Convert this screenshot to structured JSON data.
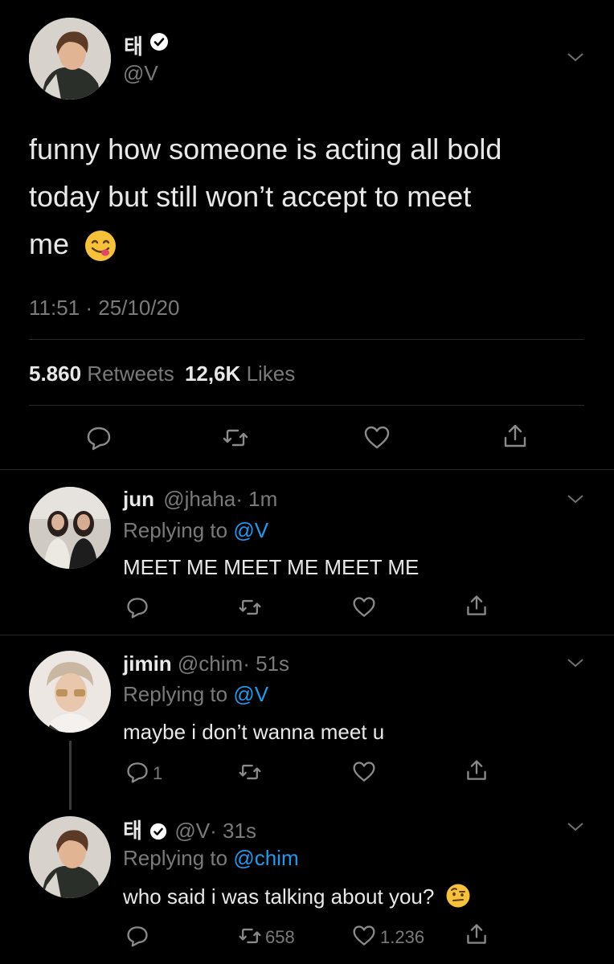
{
  "main_tweet": {
    "display_name": "태",
    "handle": "@V",
    "text_line1": "funny how someone is acting all bold",
    "text_line2": "today but still won’t accept to meet",
    "text_line3": "me",
    "emoji": "yum-face-emoji",
    "timestamp": "11:51 · 25/10/20",
    "retweets_count": "5.860",
    "retweets_label": "Retweets",
    "likes_count": "12,6K",
    "likes_label": "Likes"
  },
  "replies": [
    {
      "display_name": "jun",
      "handle": "@jhaha",
      "time": "· 1m",
      "replying_prefix": "Replying to",
      "replying_to": "@V",
      "text": "MEET ME MEET ME MEET ME",
      "reply_count": "",
      "retweet_count": "",
      "like_count": ""
    },
    {
      "display_name": "jimin",
      "handle": "@chim",
      "time": "· 51s",
      "replying_prefix": "Replying to",
      "replying_to": "@V",
      "text": "maybe i don’t wanna meet u",
      "reply_count": "1",
      "retweet_count": "",
      "like_count": ""
    },
    {
      "display_name": "태",
      "handle": "@V",
      "time": "· 31s",
      "replying_prefix": "Replying to",
      "replying_to": "@chim",
      "text": "who said i was talking about you?",
      "emoji": "raised-eyebrow-face-emoji",
      "reply_count": "",
      "retweet_count": "658",
      "like_count": "1.236"
    }
  ],
  "colors": {
    "background": "#000000",
    "link": "#1d9bf0",
    "muted": "#7a7a7a",
    "verified": "#ffffff"
  }
}
